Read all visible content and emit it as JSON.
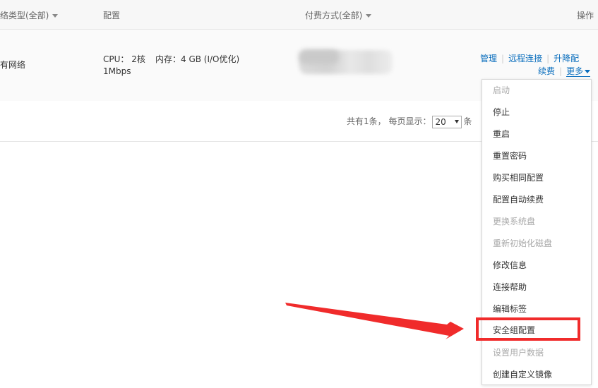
{
  "header": {
    "network_type": "网络类型(全部)",
    "config": "配置",
    "billing": "付费方式(全部)",
    "actions": "操作"
  },
  "instance": {
    "network": "专有网络",
    "cpu": "CPU： 2核",
    "memory": "内存：4 GB (I/O优化)",
    "bandwidth": "1Mbps"
  },
  "row_actions": {
    "manage": "管理",
    "remote_connect": "远程连接",
    "upgrade": "升降配",
    "renew": "续费",
    "more": "更多"
  },
  "pagination": {
    "total_prefix": "共有1条，",
    "per_page_label": "每页显示：",
    "per_page_value": "20",
    "suffix": "条"
  },
  "more_menu": {
    "items": [
      {
        "label": "启动",
        "enabled": false
      },
      {
        "label": "停止",
        "enabled": true
      },
      {
        "label": "重启",
        "enabled": true
      },
      {
        "label": "重置密码",
        "enabled": true
      },
      {
        "label": "购买相同配置",
        "enabled": true
      },
      {
        "label": "配置自动续费",
        "enabled": true
      },
      {
        "label": "更换系统盘",
        "enabled": false
      },
      {
        "label": "重新初始化磁盘",
        "enabled": false
      },
      {
        "label": "修改信息",
        "enabled": true
      },
      {
        "label": "连接帮助",
        "enabled": true
      },
      {
        "label": "编辑标签",
        "enabled": true
      },
      {
        "label": "安全组配置",
        "enabled": true
      },
      {
        "label": "设置用户数据",
        "enabled": false
      },
      {
        "label": "创建自定义镜像",
        "enabled": true
      }
    ]
  },
  "colors": {
    "link": "#0a6ebd",
    "annotation_red": "#f02b2b"
  }
}
